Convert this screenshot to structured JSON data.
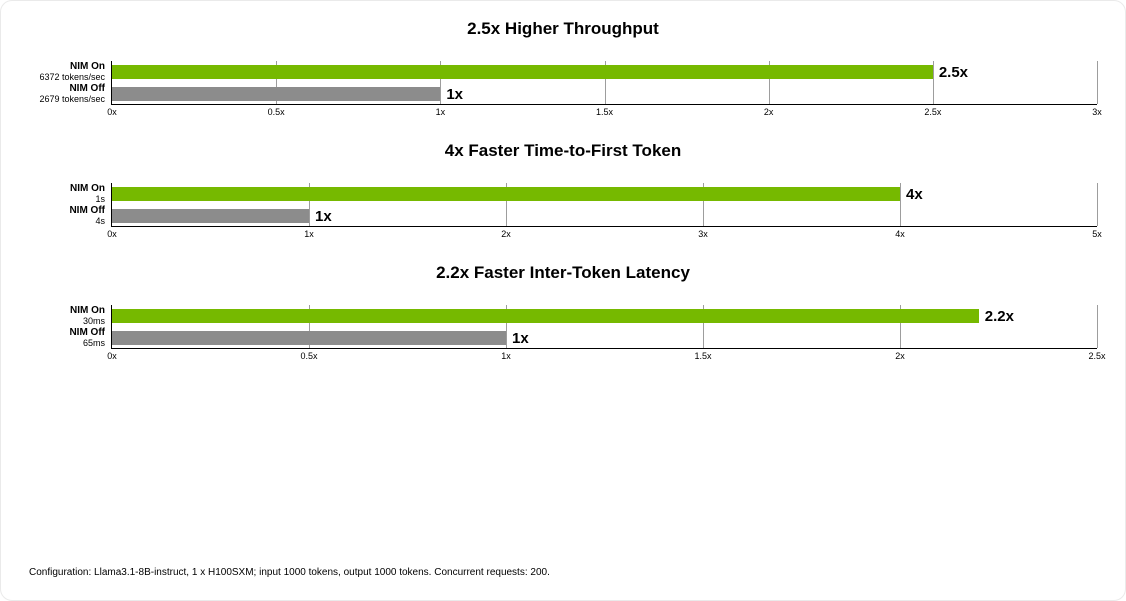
{
  "chart_data": [
    {
      "type": "bar",
      "title": "2.5x Higher Throughput",
      "xlabel": "",
      "ylabel": "",
      "xlim": [
        0,
        3
      ],
      "ticks": [
        {
          "v": 0,
          "label": "0x"
        },
        {
          "v": 0.5,
          "label": "0.5x"
        },
        {
          "v": 1,
          "label": "1x"
        },
        {
          "v": 1.5,
          "label": "1.5x"
        },
        {
          "v": 2,
          "label": "2x"
        },
        {
          "v": 2.5,
          "label": "2.5x"
        },
        {
          "v": 3,
          "label": "3x"
        }
      ],
      "categories": [
        {
          "name": "NIM On",
          "sub": "6372 tokens/sec"
        },
        {
          "name": "NIM Off",
          "sub": "2679 tokens/sec"
        }
      ],
      "series": [
        {
          "name": "NIM On",
          "value": 2.5,
          "label": "2.5x",
          "color": "green"
        },
        {
          "name": "NIM Off",
          "value": 1.0,
          "label": "1x",
          "color": "gray"
        }
      ]
    },
    {
      "type": "bar",
      "title": "4x Faster Time-to-First Token",
      "xlabel": "",
      "ylabel": "",
      "xlim": [
        0,
        5
      ],
      "ticks": [
        {
          "v": 0,
          "label": "0x"
        },
        {
          "v": 1,
          "label": "1x"
        },
        {
          "v": 2,
          "label": "2x"
        },
        {
          "v": 3,
          "label": "3x"
        },
        {
          "v": 4,
          "label": "4x"
        },
        {
          "v": 5,
          "label": "5x"
        }
      ],
      "categories": [
        {
          "name": "NIM On",
          "sub": "1s"
        },
        {
          "name": "NIM Off",
          "sub": "4s"
        }
      ],
      "series": [
        {
          "name": "NIM On",
          "value": 4.0,
          "label": "4x",
          "color": "green"
        },
        {
          "name": "NIM Off",
          "value": 1.0,
          "label": "1x",
          "color": "gray"
        }
      ]
    },
    {
      "type": "bar",
      "title": "2.2x Faster Inter-Token Latency",
      "xlabel": "",
      "ylabel": "",
      "xlim": [
        0,
        2.5
      ],
      "ticks": [
        {
          "v": 0,
          "label": "0x"
        },
        {
          "v": 0.5,
          "label": "0.5x"
        },
        {
          "v": 1,
          "label": "1x"
        },
        {
          "v": 1.5,
          "label": "1.5x"
        },
        {
          "v": 2,
          "label": "2x"
        },
        {
          "v": 2.5,
          "label": "2.5x"
        }
      ],
      "categories": [
        {
          "name": "NIM On",
          "sub": "30ms"
        },
        {
          "name": "NIM Off",
          "sub": "65ms"
        }
      ],
      "series": [
        {
          "name": "NIM On",
          "value": 2.2,
          "label": "2.2x",
          "color": "green"
        },
        {
          "name": "NIM Off",
          "value": 1.0,
          "label": "1x",
          "color": "gray"
        }
      ]
    }
  ],
  "footnote": "Configuration: Llama3.1-8B-instruct, 1 x H100SXM; input 1000 tokens, output 1000 tokens. Concurrent requests: 200."
}
